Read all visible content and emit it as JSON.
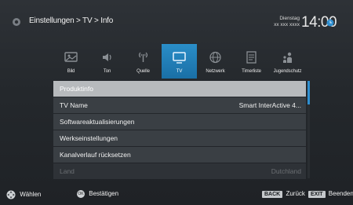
{
  "header": {
    "breadcrumb": "Einstellungen > TV > Info",
    "weekday": "Dienstag",
    "date": "xx xxx xxxx",
    "time": "14:00",
    "settings_icon": "gear-icon",
    "time_icon": "clock-icon"
  },
  "tabs": [
    {
      "label": "Bild",
      "icon": "picture-icon",
      "active": false
    },
    {
      "label": "Ton",
      "icon": "speaker-icon",
      "active": false
    },
    {
      "label": "Quelle",
      "icon": "source-antenna-icon",
      "active": false
    },
    {
      "label": "TV",
      "icon": "tv-icon",
      "active": true
    },
    {
      "label": "Netzwerk",
      "icon": "network-icon",
      "active": false
    },
    {
      "label": "Timerliste",
      "icon": "timer-list-icon",
      "active": false
    },
    {
      "label": "Jugendschutz",
      "icon": "parental-control-icon",
      "active": false
    }
  ],
  "menu": {
    "items": [
      {
        "label": "Produktinfo",
        "value": "",
        "selected": true
      },
      {
        "label": "TV Name",
        "value": "Smart InterActive 4...",
        "selected": false
      },
      {
        "label": "Softwareaktualisierungen",
        "value": "",
        "selected": false
      },
      {
        "label": "Werkseinstellungen",
        "value": "",
        "selected": false
      },
      {
        "label": "Kanalverlauf rücksetzen",
        "value": "",
        "selected": false
      },
      {
        "label": "Land",
        "value": "Dutchland",
        "disabled": true
      }
    ]
  },
  "footer": {
    "select_label": "Wählen",
    "ok_key": "OK",
    "confirm_label": "Bestätigen",
    "back_key": "BACK",
    "back_label": "Zurück",
    "exit_key": "EXIT",
    "exit_label": "Beenden"
  },
  "colors": {
    "accent": "#1f7ab8",
    "selected_row": "#b7babd",
    "background": "#2a2e33"
  }
}
